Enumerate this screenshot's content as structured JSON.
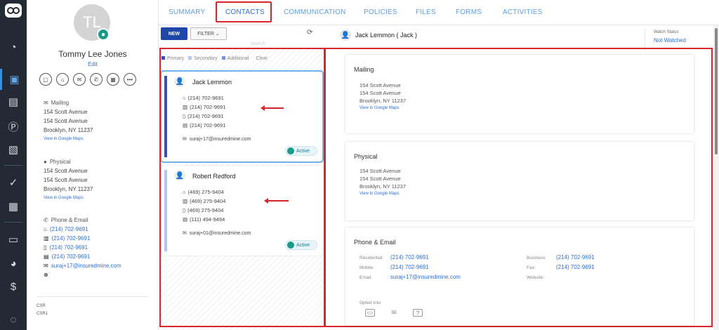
{
  "profile": {
    "initials": "TL",
    "name": "Tommy Lee Jones",
    "edit_label": "Edit",
    "mailing": {
      "heading": "Mailing",
      "line1": "154 Scott Avenue",
      "line2": "154 Scott Avenue",
      "line3": "Brooklyn, NY 11237",
      "map_link": "View in Google Maps"
    },
    "physical": {
      "heading": "Physical",
      "line1": "154 Scott Avenue",
      "line2": "154 Scott Avenue",
      "line3": "Brooklyn, NY 11237",
      "map_link": "View in Google Maps"
    },
    "phone_email": {
      "heading": "Phone & Email",
      "residential": "(214) 702-9691",
      "business": "(214) 702-9691",
      "mobile": "(214) 702-9691",
      "fax": "(214) 702-9691",
      "email": "suraj+17@insuredmine.com"
    },
    "footer": {
      "line1": "CSR",
      "line2": "CSR1"
    }
  },
  "tabs": [
    {
      "label": "SUMMARY"
    },
    {
      "label": "CONTACTS"
    },
    {
      "label": "COMMUNICATION"
    },
    {
      "label": "POLICIES"
    },
    {
      "label": "FILES"
    },
    {
      "label": "FORMS"
    },
    {
      "label": "ACTIVITIES"
    }
  ],
  "list": {
    "new_label": "NEW",
    "filter_label": "FILTER ⌄",
    "search_placeholder": "search",
    "legend": [
      "Primary",
      "Secondary",
      "Additional"
    ],
    "clear_label": "Clear",
    "colors": {
      "primary": "#3b4fb0",
      "secondary": "#b9c3ee",
      "additional": "#7e8fe6"
    },
    "contacts": [
      {
        "name": "Jack Lemmon",
        "residential": "(214) 702-9691",
        "business": "(214) 702-9691",
        "mobile": "(214) 702-9691",
        "fax": "(214) 702-9691",
        "email": "suraj+17@insuredmine.com",
        "status": "Active"
      },
      {
        "name": "Robert Redford",
        "residential": "(469) 275-9404",
        "business": "(469) 275-9404",
        "mobile": "(469) 275-9404",
        "fax": "(111) 494-9494",
        "email": "suraj+01@insuredmine.com",
        "status": "Active"
      }
    ]
  },
  "detail": {
    "header_name": "Jack Lemmon ( Jack )",
    "watch_label": "Watch Status",
    "watch_value": "Not Watched",
    "mailing": {
      "title": "Mailing",
      "line1": "154 Scott Avenue",
      "line2": "154 Scott Avenue",
      "line3": "Brooklyn, NY 11237",
      "map_link": "View in Google Maps"
    },
    "physical": {
      "title": "Physical",
      "line1": "154 Scott Avenue",
      "line2": "154 Scott Avenue",
      "line3": "Brooklyn, NY 11237",
      "map_link": "View in Google Maps"
    },
    "phone_email": {
      "title": "Phone & Email",
      "residential_label": "Residential:",
      "residential": "(214) 702-9691",
      "mobile_label": "Mobile:",
      "mobile": "(214) 702-9691",
      "email_label": "Email:",
      "email": "suraj+17@insuredmine.com",
      "business_label": "Business:",
      "business": "(214) 702-9691",
      "fax_label": "Fax:",
      "fax": "(214) 702-9691",
      "website_label": "Website:",
      "opted_label": "Opted into"
    }
  },
  "accent_red": "#d9252d"
}
